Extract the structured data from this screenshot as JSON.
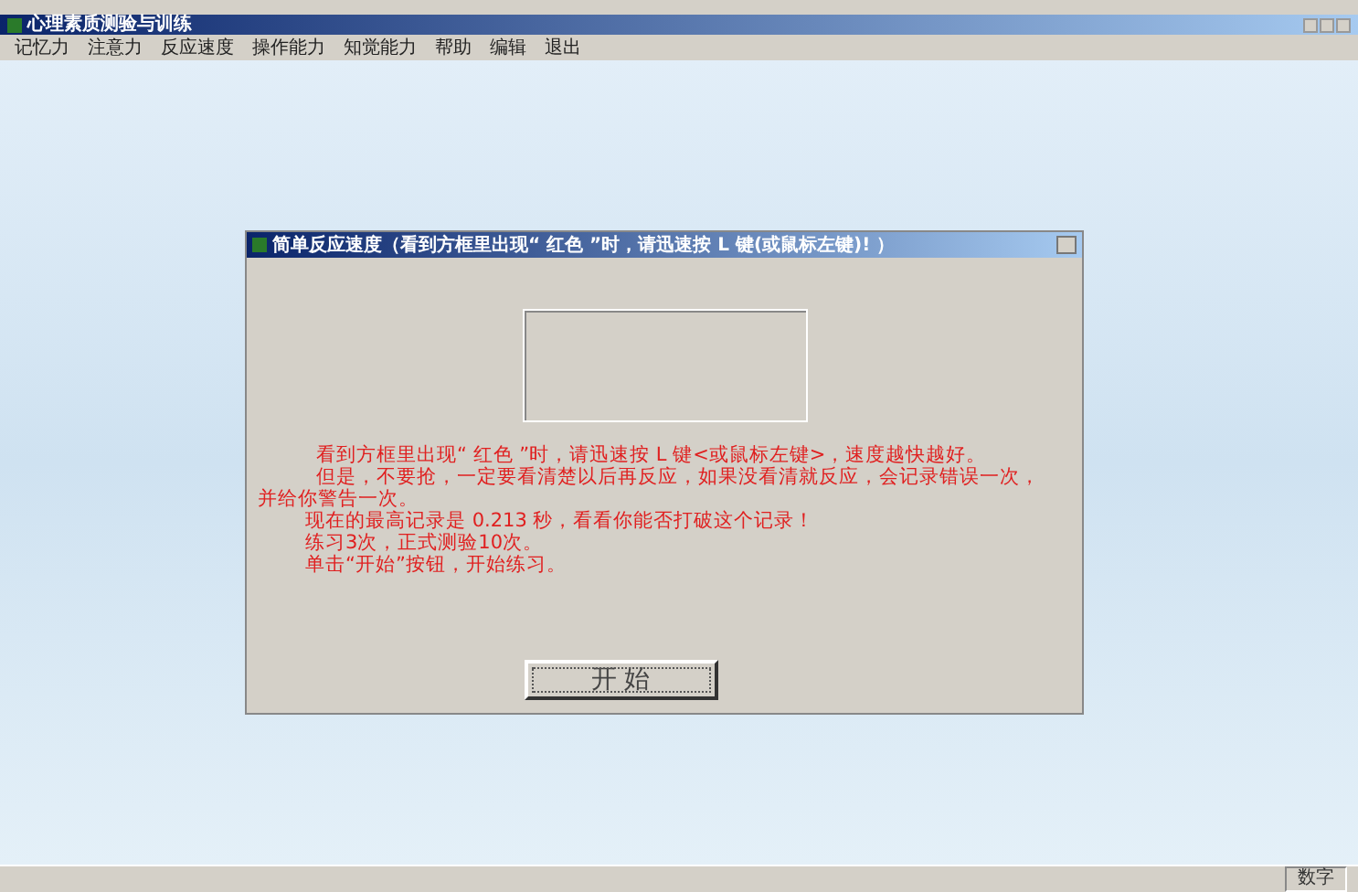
{
  "window": {
    "title": "心理素质测验与训练"
  },
  "menu": [
    {
      "label": "记忆力"
    },
    {
      "label": "注意力"
    },
    {
      "label": "反应速度"
    },
    {
      "label": "操作能力"
    },
    {
      "label": "知觉能力"
    },
    {
      "label": "帮助"
    },
    {
      "label": "编辑"
    },
    {
      "label": "退出"
    }
  ],
  "dialog": {
    "title": "简单反应速度（看到方框里出现“ 红色 ”时，请迅速按 L 键(或鼠标左键)! ）",
    "instructions": [
      "看到方框里出现“ 红色 ”时，请迅速按 L 键<或鼠标左键>，速度越快越好。",
      "但是，不要抢，一定要看清楚以后再反应，如果没看清就反应，会记录错误一次，并给你警告一次。",
      "现在的最高记录是 0.213 秒，看看你能否打破这个记录！",
      "练习3次，正式测验10次。",
      "单击“开始”按钮，开始练习。"
    ],
    "start_button": "开 始"
  },
  "status_bar": {
    "indicator": "数字"
  }
}
